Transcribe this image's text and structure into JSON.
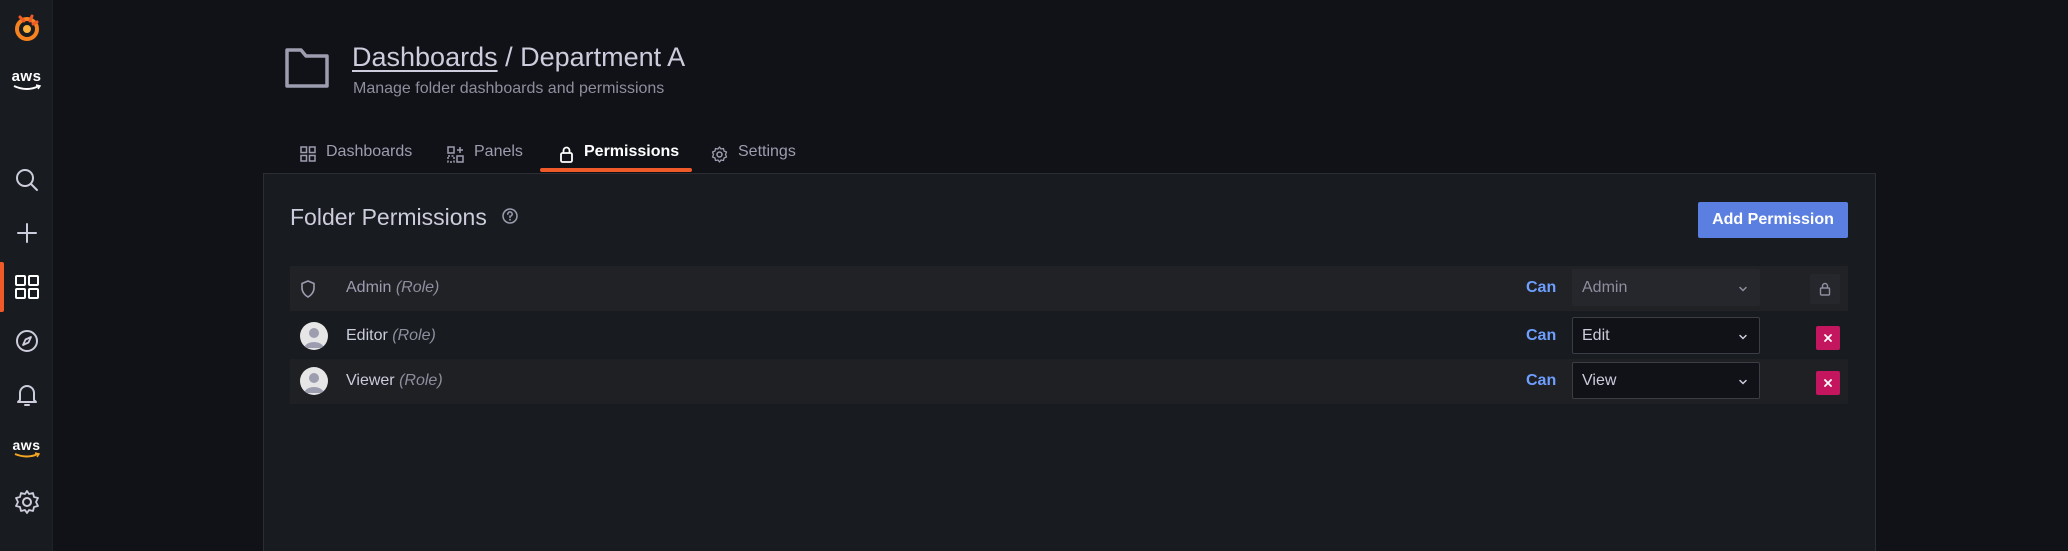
{
  "sidebar": {
    "aws_label_top": "aws",
    "aws_label_bottom": "aws"
  },
  "header": {
    "breadcrumb_link": "Dashboards",
    "separator": " / ",
    "folder_name": "Department A",
    "subtitle": "Manage folder dashboards and permissions"
  },
  "tabs": [
    {
      "label": "Dashboards",
      "icon": "apps-icon"
    },
    {
      "label": "Panels",
      "icon": "library-panel-icon"
    },
    {
      "label": "Permissions",
      "icon": "lock-icon",
      "active": true
    },
    {
      "label": "Settings",
      "icon": "cog-icon"
    }
  ],
  "panel": {
    "title": "Folder Permissions",
    "add_button": "Add Permission"
  },
  "permissions": [
    {
      "name": "Admin",
      "role_suffix": "(Role)",
      "can": "Can",
      "permission": "Admin",
      "locked": true
    },
    {
      "name": "Editor",
      "role_suffix": "(Role)",
      "can": "Can",
      "permission": "Edit",
      "locked": false
    },
    {
      "name": "Viewer",
      "role_suffix": "(Role)",
      "can": "Can",
      "permission": "View",
      "locked": false
    }
  ],
  "colors": {
    "accent": "#f05a28",
    "primary_button": "#5b7fe0",
    "danger": "#c4165f",
    "link": "#6e9fff"
  }
}
